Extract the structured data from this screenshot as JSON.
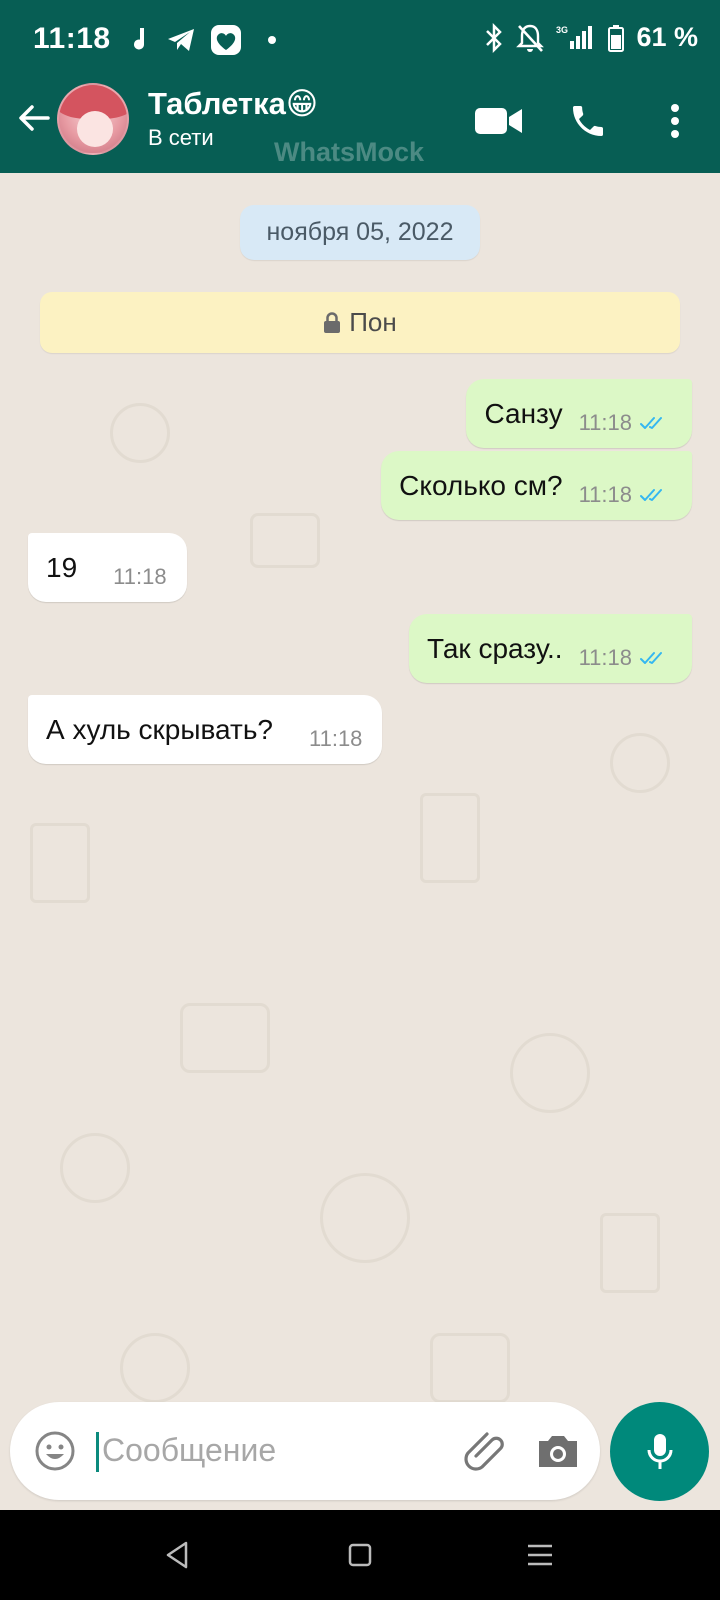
{
  "status_bar": {
    "time": "11:18",
    "battery": "61 %",
    "network": "3G"
  },
  "header": {
    "contact_name": "Таблетка😁",
    "contact_status": "В сети",
    "watermark": "WhatsMock",
    "icons": [
      "back-arrow-icon",
      "video-call-icon",
      "phone-call-icon",
      "more-vert-icon"
    ]
  },
  "chat": {
    "date_label": "ноября 05, 2022",
    "system_message": "Пон",
    "messages": [
      {
        "direction": "out",
        "text": "Санзу",
        "time": "11:18",
        "status": "read"
      },
      {
        "direction": "out",
        "text": "Сколько см?",
        "time": "11:18",
        "status": "read"
      },
      {
        "direction": "in",
        "text": "19",
        "time": "11:18"
      },
      {
        "direction": "out",
        "text": "Так сразу..",
        "time": "11:18",
        "status": "read"
      },
      {
        "direction": "in",
        "text": "А хуль скрывать?",
        "time": "11:18"
      }
    ]
  },
  "input": {
    "placeholder": "Сообщение"
  },
  "colors": {
    "header": "#075E54",
    "chat_bg": "#ECE5DD",
    "outgoing_bubble": "#DCF8C6",
    "incoming_bubble": "#FFFFFF",
    "date_chip": "#D8E9F6",
    "system_chip": "#FCF2C2",
    "read_tick": "#34B7F1",
    "mic_button": "#00897B"
  }
}
